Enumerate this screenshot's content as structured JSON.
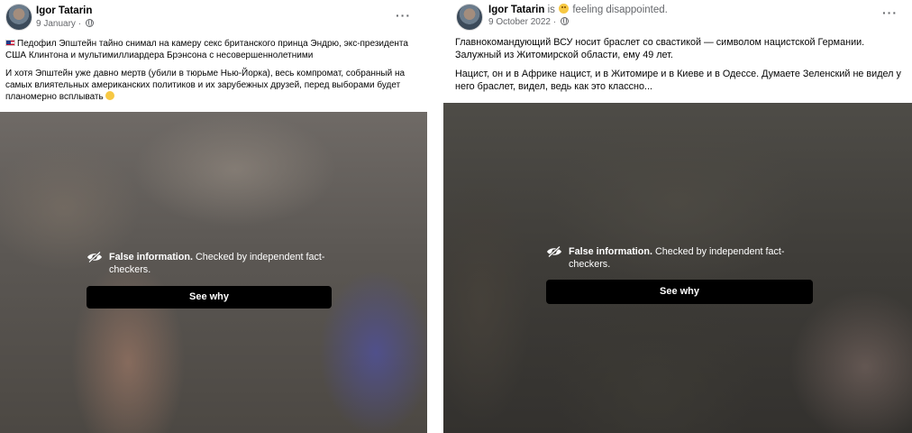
{
  "posts": [
    {
      "author": "Igor Tatarin",
      "feeling": "",
      "date": "9 January ·",
      "paragraph_1": "Педофил Эпштейн тайно снимал на камеру секс британского принца Эндрю, экс-президента США Клинтона и мультимиллиардера Брэнсона с несовершеннолетними",
      "paragraph_2": "И хотя Эпштейн уже давно мертв (убили в тюрьме Нью-Йорка), весь компромат, собранный на самых влиятельных американских политиков и их зарубежных друзей, перед выборами будет планомерно всплывать",
      "warning_bold": "False information.",
      "warning_rest": "Checked by independent fact-checkers.",
      "button_label": "See why"
    },
    {
      "author": "Igor Tatarin",
      "feeling_is": "is",
      "feeling": "feeling disappointed.",
      "date": "9 October 2022 ·",
      "paragraph_1": "Главнокомандующий ВСУ носит браслет со свастикой — символом нацистской Германии. Залужный из Житомирской области, ему 49 лет.",
      "paragraph_2": "Нацист, он и в Африке нацист, и в Житомире и в Киеве и в Одессе. Думаете Зеленский не видел у него браслет, видел, ведь как это классно...",
      "warning_bold": "False information.",
      "warning_rest": "Checked by independent fact-checkers.",
      "button_label": "See why"
    }
  ],
  "more_icon_glyph": "···",
  "colors": {
    "text_primary": "#050505",
    "text_secondary": "#65676b",
    "button_bg": "#000000",
    "warning_text": "#ffffff"
  }
}
